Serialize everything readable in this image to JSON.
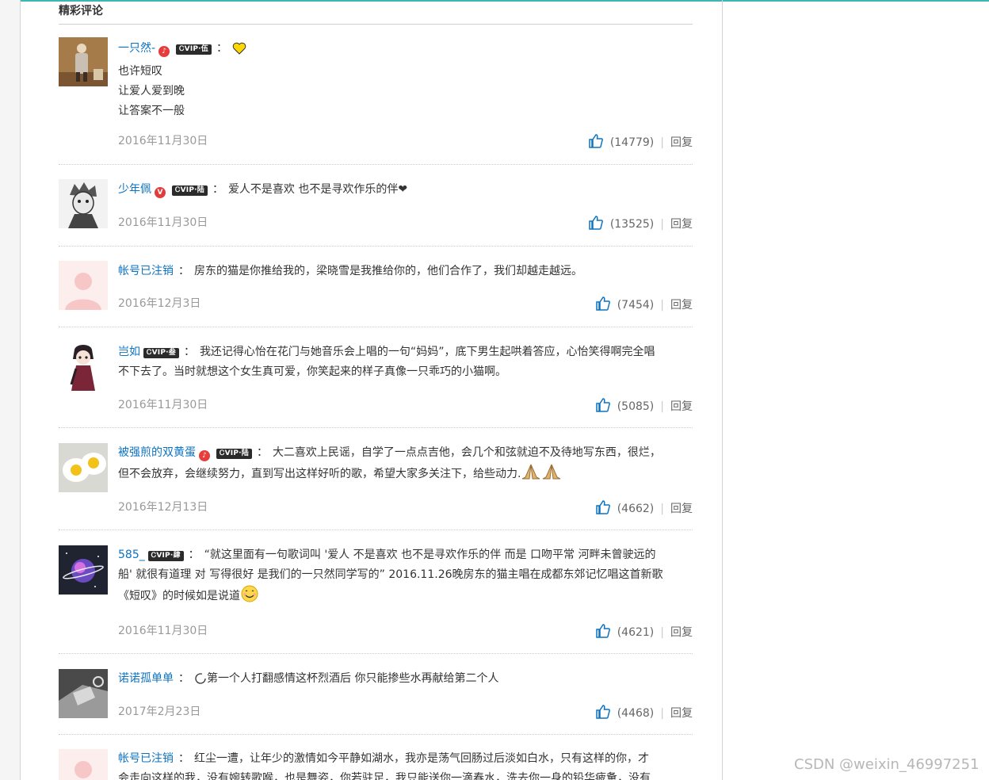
{
  "section_title": "精彩评论",
  "reply_label": "回复",
  "comments": [
    {
      "user": "一只然-",
      "badge": "red-circle",
      "vip": "ᏟVIP·伍",
      "lines": [
        "",
        "也许短叹",
        "让爱人爱到晚",
        "让答案不一般"
      ],
      "date": "2016年11月30日",
      "likes": "(14779)",
      "avatar": "portrait-figure"
    },
    {
      "user": "少年佩",
      "badge": "v-circle",
      "vip": "ᏟVIP·陆",
      "lines": [
        "爱人不是喜欢 也不是寻欢作乐的伴❤"
      ],
      "date": "2016年11月30日",
      "likes": "(13525)",
      "avatar": "sketch-boy"
    },
    {
      "user": "帐号已注销",
      "lines": [
        "房东的猫是你推给我的，梁晓雪是我推给你的，他们合作了，我们却越走越远。"
      ],
      "date": "2016年12月3日",
      "likes": "(7454)",
      "avatar": "default-pink"
    },
    {
      "user": "岂如",
      "vip": "ᏟVIP·叁",
      "lines": [
        "我还记得心怡在花门与她音乐会上唱的一句“妈妈”，底下男生起哄着答应，心怡笑得啊完全唱",
        "不下去了。当时就想这个女生真可爱，你笑起来的样子真像一只乖巧的小猫啊。"
      ],
      "date": "2016年11月30日",
      "likes": "(5085)",
      "avatar": "cartoon-girl"
    },
    {
      "user": "被强煎的双黄蛋",
      "badge": "red-circle",
      "vip": "ᏟVIP·陆",
      "lines": [
        "大二喜欢上民谣，自学了一点点吉他，会几个和弦就迫不及待地写东西，很烂，",
        "但不会放弃，会继续努力，直到写出这样好听的歌，希望大家多关注下，给些动力."
      ],
      "date": "2016年12月13日",
      "likes": "(4662)",
      "avatar": "fried-eggs"
    },
    {
      "user": "585_",
      "vip": "ᏟVIP·肆",
      "lines": [
        "“就这里面有一句歌词叫 '爱人 不是喜欢 也不是寻欢作乐的伴 而是 口吻平常 河畔未曾驶远的",
        "船' 就很有道理 对 写得很好 是我们的一只然同学写的” 2016.11.26晚房东的猫主唱在成都东郊记忆唱这首新歌",
        "《短叹》的时候如是说道"
      ],
      "date": "2016年11月30日",
      "likes": "(4621)",
      "avatar": "galaxy"
    },
    {
      "user": "诺诺孤单单",
      "lines": [
        "第一个人打翻感情这杯烈酒后 你只能掺些水再献给第二个人"
      ],
      "date": "2017年2月23日",
      "likes": "(4468)",
      "avatar": "bw-hand"
    },
    {
      "user": "帐号已注销",
      "lines": [
        "红尘一遭，让年少的激情如今平静如湖水，我亦是荡气回肠过后淡如白水，只有这样的你，才",
        "会走向这样的我，没有婉转歌喉，也是舞姿，你若驻足，我只能送你一滴春水，洗去你一身的铅华疲惫，没有"
      ],
      "date": "",
      "likes": "",
      "avatar": "default-pink"
    }
  ],
  "watermark": "CSDN @weixin_46997251"
}
